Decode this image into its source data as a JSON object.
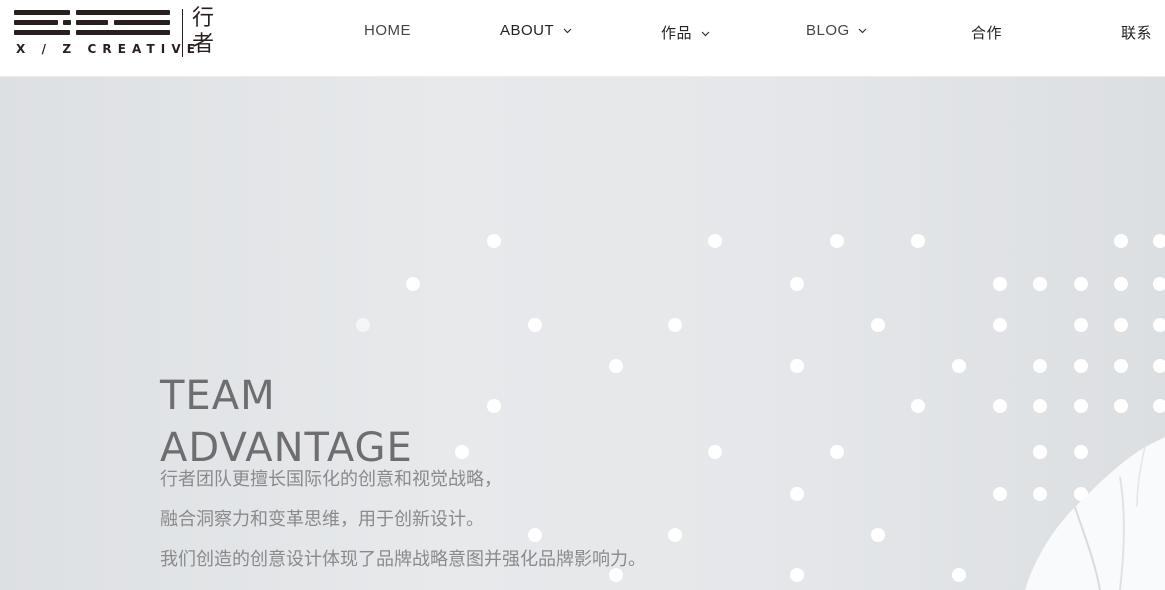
{
  "logo": {
    "subtitle": "X / Z CREATIVE",
    "cn_top": "行",
    "cn_bottom": "者"
  },
  "nav": {
    "home": "HOME",
    "about": "ABOUT",
    "works": "作品",
    "blog": "BLOG",
    "cooperate": "合作",
    "contact": "联系"
  },
  "hero": {
    "title_line1": "TEAM",
    "title_line2": "ADVANTAGE",
    "desc": [
      "行者团队更擅长国际化的创意和视觉战略，",
      "融合洞察力和变革思维，用于创新设计。",
      "我们创造的创意设计体现了品牌战略意图并强化品牌影响力。"
    ]
  },
  "colors": {
    "logo": "#2a1f1f",
    "hero_bg": "#e5e7ea",
    "title": "#6e6e70",
    "desc": "#8a8a8c",
    "dot": "#ffffff"
  }
}
